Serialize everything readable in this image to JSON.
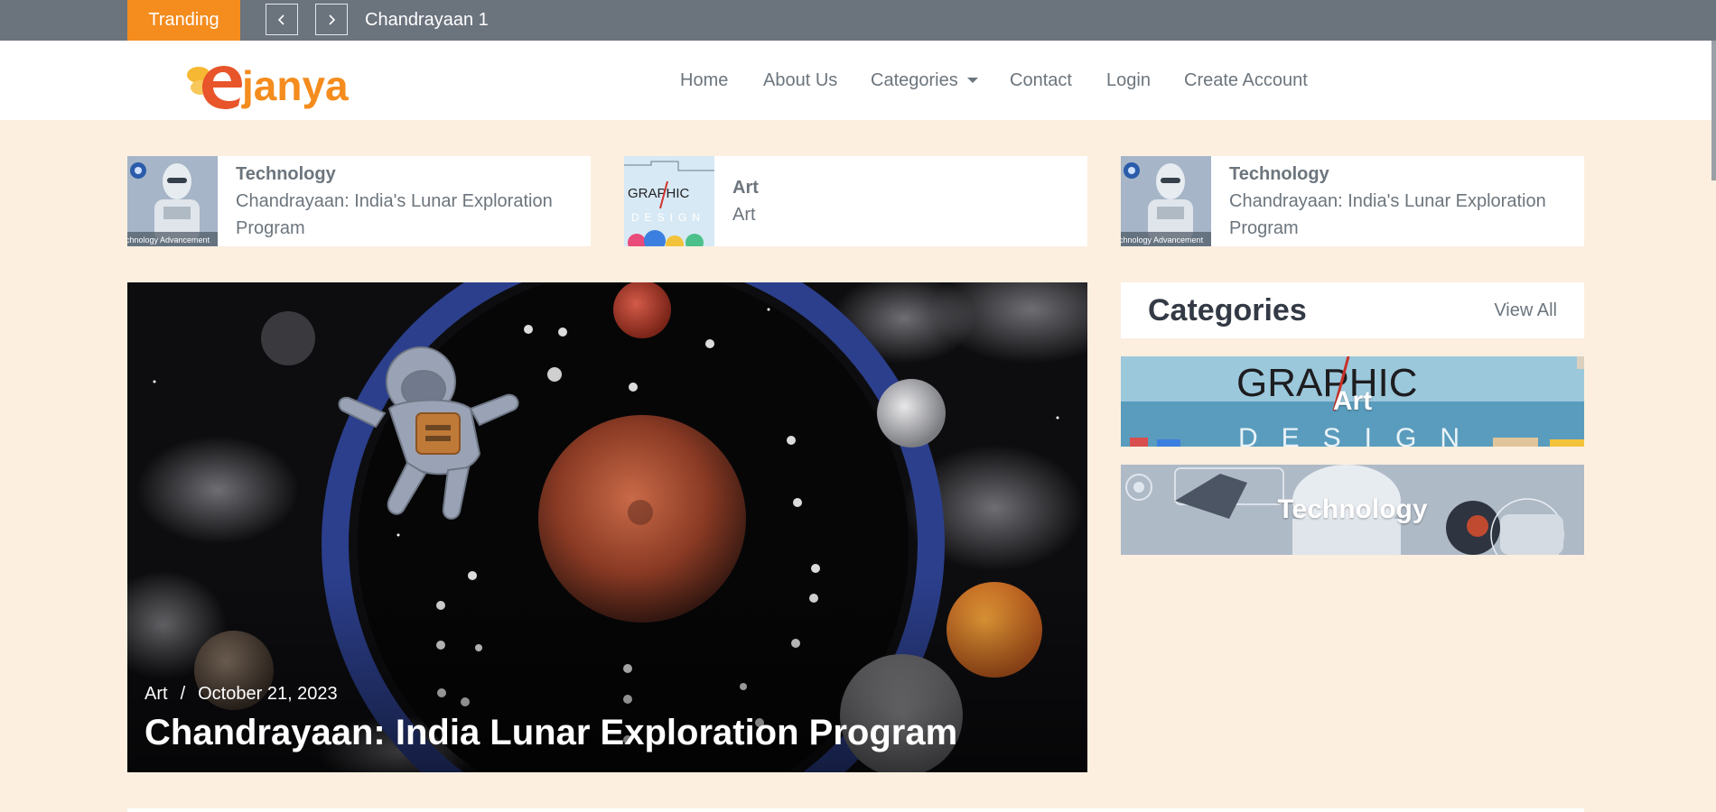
{
  "trending": {
    "label": "Tranding",
    "prev_icon": "chevron-left-icon",
    "next_icon": "chevron-right-icon",
    "current_title": "Chandrayaan 1"
  },
  "brand": {
    "logo_text": "ejanya",
    "accent": "#f48c1e",
    "accent_red": "#e8552b",
    "bee_yellow": "#f6b833"
  },
  "nav": {
    "home": "Home",
    "about": "About Us",
    "categories": "Categories",
    "contact": "Contact",
    "login": "Login",
    "create_account": "Create Account"
  },
  "strip": [
    {
      "category": "Technology",
      "title": "Chandrayaan: India's Lunar Exploration Program",
      "thumb_caption": "chnology Advancement"
    },
    {
      "category": "Art",
      "title": "Art",
      "thumb_caption": "GRAPHIC"
    },
    {
      "category": "Technology",
      "title": "Chandrayaan: India's Lunar Exploration Program",
      "thumb_caption": "chnology Advancement"
    }
  ],
  "hero": {
    "category": "Art",
    "separator": "/",
    "date": "October 21, 2023",
    "title": "Chandrayaan: India Lunar Exploration Program"
  },
  "sidebar": {
    "heading": "Categories",
    "view_all": "View All",
    "tiles": [
      {
        "label": "Art",
        "bg_text": "GRAPHIC"
      },
      {
        "label": "Technology"
      }
    ]
  }
}
